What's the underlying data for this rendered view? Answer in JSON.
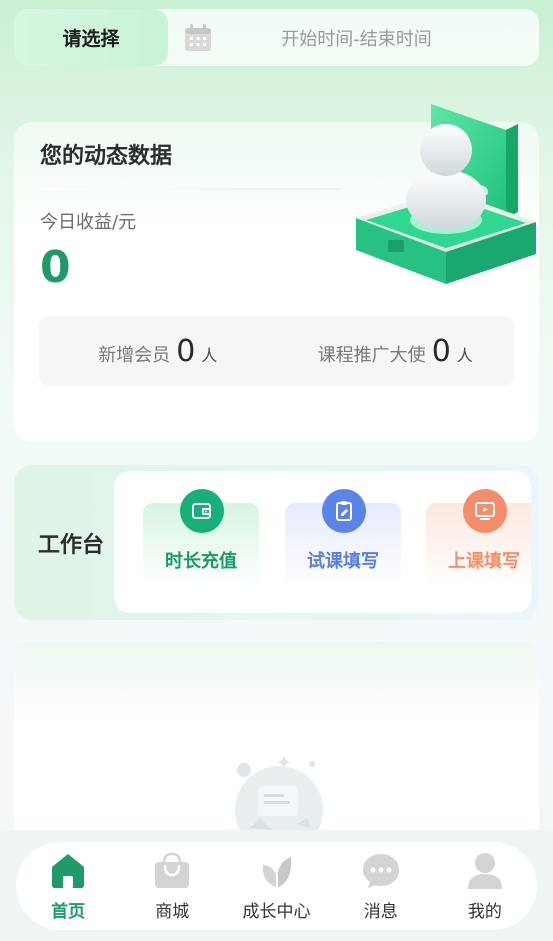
{
  "filter": {
    "select_label": "请选择",
    "date_range": "开始时间-结束时间",
    "calendar_icon": "calendar-icon"
  },
  "stats": {
    "title": "您的动态数据",
    "income_label": "今日收益/元",
    "income_value": "0",
    "new_members_label": "新增会员",
    "new_members_value": "0",
    "new_members_unit": "人",
    "ambassadors_label": "课程推广大使",
    "ambassadors_value": "0",
    "ambassadors_unit": "人"
  },
  "workbench": {
    "title": "工作台",
    "tiles": [
      {
        "label": "时长充值",
        "icon": "wallet-icon",
        "color": "#17b07a"
      },
      {
        "label": "试课填写",
        "icon": "clipboard-icon",
        "color": "#5b84e8"
      },
      {
        "label": "上课填写",
        "icon": "video-icon",
        "color": "#f58c6a"
      }
    ]
  },
  "nav": {
    "items": [
      {
        "label": "首页",
        "icon": "home-icon",
        "active": true
      },
      {
        "label": "商城",
        "icon": "shopping-bag-icon",
        "active": false
      },
      {
        "label": "成长中心",
        "icon": "leaf-icon",
        "active": false
      },
      {
        "label": "消息",
        "icon": "chat-icon",
        "active": false
      },
      {
        "label": "我的",
        "icon": "user-icon",
        "active": false
      }
    ]
  },
  "colors": {
    "accent": "#1f9a6b",
    "tile_green": "#17b07a",
    "tile_blue": "#5b84e8",
    "tile_orange": "#f58c6a"
  }
}
